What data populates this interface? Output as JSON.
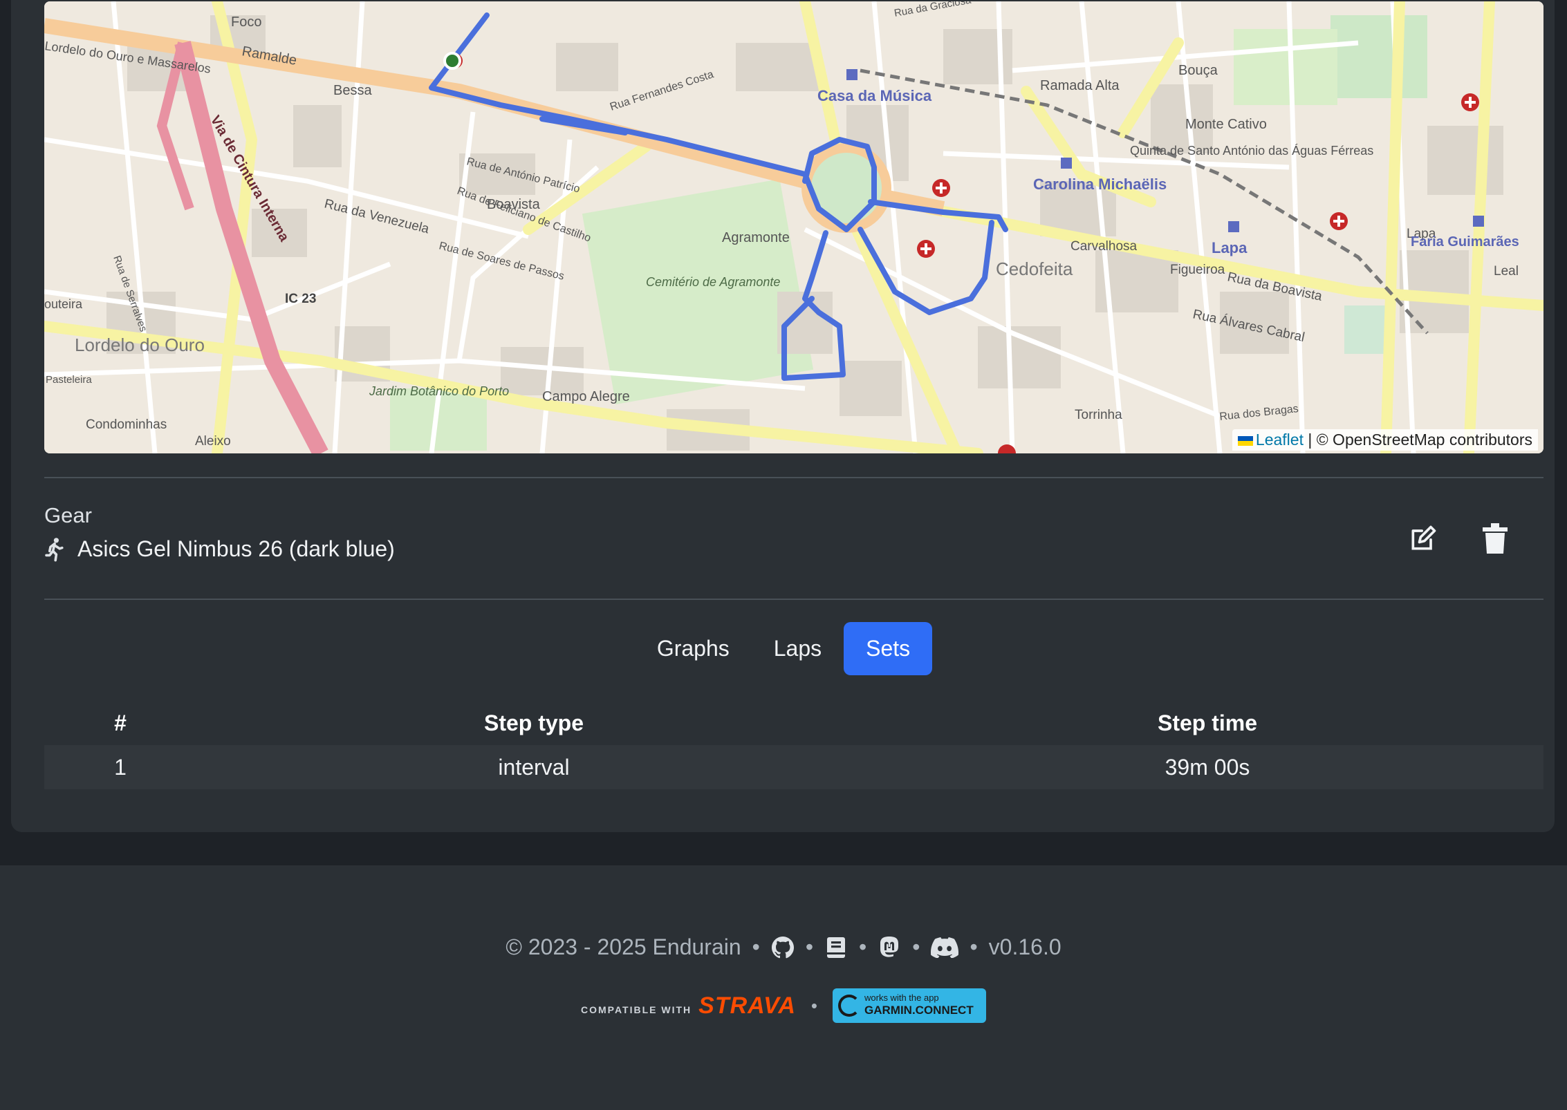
{
  "map": {
    "labels": {
      "foco": "Foco",
      "ouro_massarelos": "Lordelo do Ouro e Massarelos",
      "ramalde": "Ramalde",
      "bessa": "Bessa",
      "casa_musica": "Casa da Música",
      "rua_graciosa": "Rua da Graciosa",
      "ramada_alta": "Ramada Alta",
      "bouca": "Bouça",
      "monte_cativo": "Monte Cativo",
      "quinta": "Quinta de Santo António das Águas Férreas",
      "carolina": "Carolina Michaëlis",
      "boavista": "Boavista",
      "agramonte": "Agramonte",
      "cemiterio": "Cemitério de Agramonte",
      "cedofeita": "Cedofeita",
      "carvalhosa": "Carvalhosa",
      "lapa_station": "Lapa",
      "lapa": "Lapa",
      "faria": "Faria Guimarães",
      "leal": "Leal",
      "figueiroa": "Figueiroa",
      "rua_boavista": "Rua da Boavista",
      "rua_alvares": "Rua Álvares Cabral",
      "campo_alegre": "Campo Alegre",
      "jardim": "Jardim Botânico do Porto",
      "lordelo": "Lordelo do Ouro",
      "condominhas": "Condominhas",
      "aleixo": "Aleixo",
      "torrinha": "Torrinha",
      "rua_bragas": "Rua dos Bragas",
      "via_cintura": "Via de Cintura Interna",
      "ic23": "IC 23",
      "rua_venezuela": "Rua da Venezuela",
      "rua_antonio": "Rua de António Patrício",
      "rua_feliciano": "Rua de Feliciano de Castilho",
      "rua_soares": "Rua de Soares de Passos",
      "rua_fernandes": "Rua Fernandes Costa",
      "pasteleira": "Pasteleira",
      "outeira": "outeira",
      "carvalhido_area": "Rua de Serralves"
    },
    "attribution_leaflet": "Leaflet",
    "attribution_rest": "| © OpenStreetMap contributors",
    "route_color": "#4a6fdc"
  },
  "gear": {
    "heading": "Gear",
    "name": "Asics Gel Nimbus 26 (dark blue)",
    "icon": "running-person-icon"
  },
  "tabs": [
    {
      "label": "Graphs",
      "active": false
    },
    {
      "label": "Laps",
      "active": false
    },
    {
      "label": "Sets",
      "active": true
    }
  ],
  "sets_table": {
    "headers": [
      "#",
      "Step type",
      "Step time"
    ],
    "rows": [
      [
        "1",
        "interval",
        "39m 00s"
      ]
    ]
  },
  "footer": {
    "copyright": "© 2023 - 2025 Endurain",
    "version": "v0.16.0",
    "sep": "•",
    "icons": [
      "github-icon",
      "docs-icon",
      "mastodon-icon",
      "discord-icon"
    ],
    "strava_small": "COMPATIBLE WITH",
    "strava_brand": "STRAVA",
    "garmin_small": "works with the app",
    "garmin_brand": "GARMIN.CONNECT"
  },
  "colors": {
    "accent": "#2f6df6",
    "background": "#1e2227",
    "card": "#2b3035"
  }
}
